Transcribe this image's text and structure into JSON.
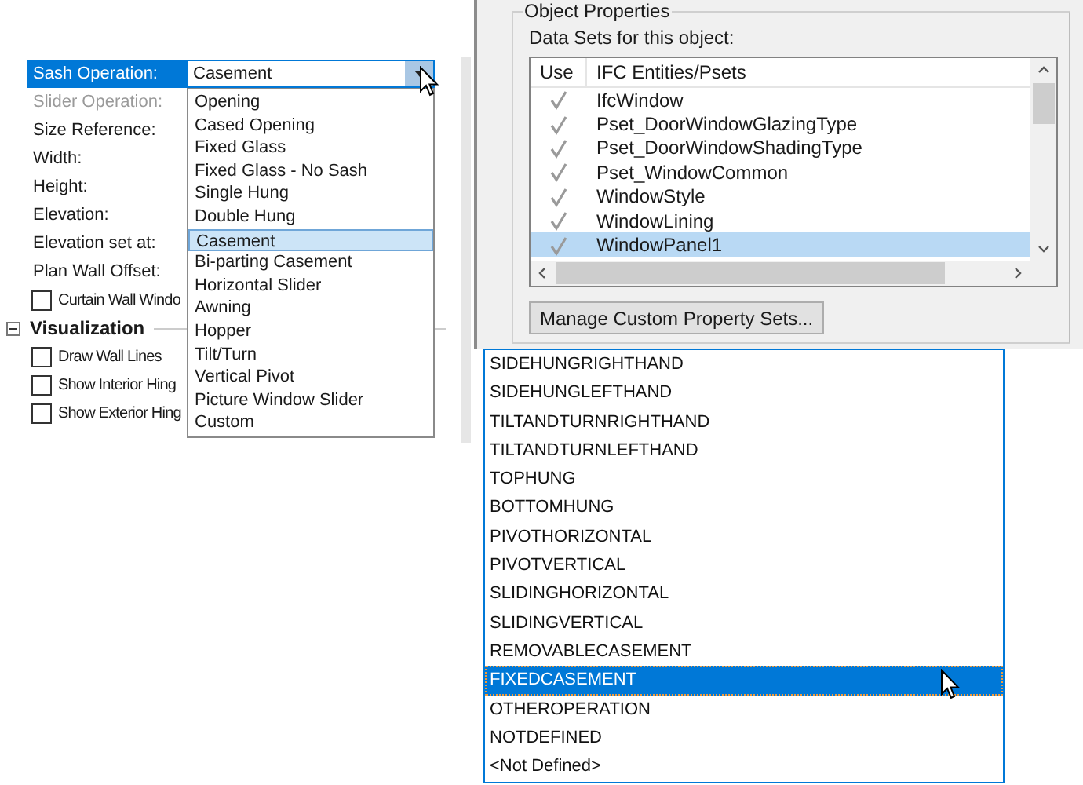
{
  "property_panel": {
    "rows": [
      {
        "kind": "field",
        "label": "Sash Operation:",
        "selected": true,
        "disabled": false
      },
      {
        "kind": "field",
        "label": "Slider Operation:",
        "selected": false,
        "disabled": true
      },
      {
        "kind": "field",
        "label": "Size Reference:",
        "selected": false,
        "disabled": false
      },
      {
        "kind": "field",
        "label": "Width:",
        "selected": false,
        "disabled": false
      },
      {
        "kind": "field",
        "label": "Height:",
        "selected": false,
        "disabled": false
      },
      {
        "kind": "field",
        "label": "Elevation:",
        "selected": false,
        "disabled": false
      },
      {
        "kind": "field",
        "label": "Elevation set at:",
        "selected": false,
        "disabled": false
      },
      {
        "kind": "field",
        "label": "Plan Wall Offset:",
        "selected": false,
        "disabled": false
      },
      {
        "kind": "checkbox",
        "label": "Curtain Wall Windo",
        "checked": false
      },
      {
        "kind": "section",
        "label": "Visualization",
        "expanded": true
      },
      {
        "kind": "checkbox",
        "label": "Draw Wall Lines",
        "checked": false
      },
      {
        "kind": "checkbox",
        "label": "Show Interior Hing",
        "checked": false
      },
      {
        "kind": "checkbox",
        "label": "Show Exterior Hing",
        "checked": false
      }
    ],
    "sash_combo": {
      "value": "Casement",
      "options": [
        {
          "label": "Opening",
          "selected": false
        },
        {
          "label": "Cased Opening",
          "selected": false
        },
        {
          "label": "Fixed Glass",
          "selected": false
        },
        {
          "label": "Fixed Glass - No Sash",
          "selected": false
        },
        {
          "label": "Single Hung",
          "selected": false
        },
        {
          "label": "Double Hung",
          "selected": false
        },
        {
          "label": "Casement",
          "selected": true
        },
        {
          "label": "Bi-parting Casement",
          "selected": false
        },
        {
          "label": "Horizontal Slider",
          "selected": false
        },
        {
          "label": "Awning",
          "selected": false
        },
        {
          "label": "Hopper",
          "selected": false
        },
        {
          "label": "Tilt/Turn",
          "selected": false
        },
        {
          "label": "Vertical Pivot",
          "selected": false
        },
        {
          "label": "Picture Window Slider",
          "selected": false
        },
        {
          "label": "Custom",
          "selected": false
        }
      ]
    }
  },
  "object_properties": {
    "title": "Object Properties",
    "caption": "Data Sets for this object:",
    "columns": [
      "Use",
      "IFC Entities/Psets"
    ],
    "rows": [
      {
        "name": "IfcWindow",
        "checked": true,
        "selected": false
      },
      {
        "name": "Pset_DoorWindowGlazingType",
        "checked": true,
        "selected": false
      },
      {
        "name": "Pset_DoorWindowShadingType",
        "checked": true,
        "selected": false
      },
      {
        "name": "Pset_WindowCommon",
        "checked": true,
        "selected": false
      },
      {
        "name": "WindowStyle",
        "checked": true,
        "selected": false
      },
      {
        "name": "WindowLining",
        "checked": true,
        "selected": false
      },
      {
        "name": "WindowPanel1",
        "checked": true,
        "selected": true
      }
    ],
    "button": "Manage Custom Property Sets..."
  },
  "operation_list": {
    "options": [
      {
        "label": "SIDEHUNGRIGHTHAND",
        "selected": false
      },
      {
        "label": "SIDEHUNGLEFTHAND",
        "selected": false
      },
      {
        "label": "TILTANDTURNRIGHTHAND",
        "selected": false
      },
      {
        "label": "TILTANDTURNLEFTHAND",
        "selected": false
      },
      {
        "label": "TOPHUNG",
        "selected": false
      },
      {
        "label": "BOTTOMHUNG",
        "selected": false
      },
      {
        "label": "PIVOTHORIZONTAL",
        "selected": false
      },
      {
        "label": "PIVOTVERTICAL",
        "selected": false
      },
      {
        "label": "SLIDINGHORIZONTAL",
        "selected": false
      },
      {
        "label": "SLIDINGVERTICAL",
        "selected": false
      },
      {
        "label": "REMOVABLECASEMENT",
        "selected": false
      },
      {
        "label": "FIXEDCASEMENT",
        "selected": true
      },
      {
        "label": "OTHEROPERATION",
        "selected": false
      },
      {
        "label": "NOTDEFINED",
        "selected": false
      },
      {
        "label": "<Not Defined>",
        "selected": false
      }
    ]
  }
}
